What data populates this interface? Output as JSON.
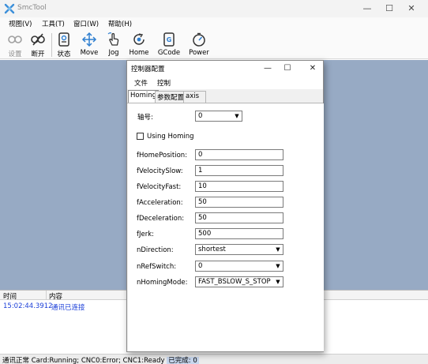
{
  "app": {
    "title": "SmcTool"
  },
  "menubar": [
    "视图(V)",
    "工具(T)",
    "窗口(W)",
    "帮助(H)"
  ],
  "toolbar": {
    "settings": "设置",
    "disconnect": "断开",
    "status": "状态",
    "move": "Move",
    "jog": "Jog",
    "home": "Home",
    "gcode": "GCode",
    "power": "Power"
  },
  "log": {
    "col_time": "时间",
    "col_content": "内容",
    "rows": [
      {
        "time": "15:02:44.3912",
        "content": "通讯已连接"
      }
    ]
  },
  "status": {
    "comm": "通讯正常",
    "detail": "Card:Running; CNC0:Error; CNC1:Ready",
    "done_label": "已完成:",
    "done_value": "0"
  },
  "dialog": {
    "title": "控制器配置",
    "menu": [
      "文件",
      "控制"
    ],
    "tabs": [
      "Homing",
      "参数配置",
      "axis"
    ],
    "axis_label": "轴号:",
    "axis_value": "0",
    "using_homing": "Using Homing",
    "using_homing_checked": false,
    "fields": [
      {
        "label": "fHomePosition:",
        "value": "0"
      },
      {
        "label": "fVelocitySlow:",
        "value": "1"
      },
      {
        "label": "fVelocityFast:",
        "value": "10"
      },
      {
        "label": "fAcceleration:",
        "value": "50"
      },
      {
        "label": "fDeceleration:",
        "value": "50"
      },
      {
        "label": "fJerk:",
        "value": "500"
      }
    ],
    "combos": [
      {
        "label": "nDirection:",
        "value": "shortest"
      },
      {
        "label": "nRefSwitch:",
        "value": "0"
      },
      {
        "label": "nHomingMode:",
        "value": "FAST_BSLOW_S_STOP"
      }
    ]
  },
  "colors": {
    "workspace": "#97aac4",
    "log_text": "#1a3ed8",
    "status_highlight": "#c8d7ee"
  }
}
